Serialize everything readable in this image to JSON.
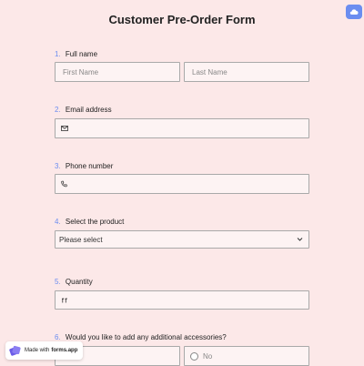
{
  "form": {
    "title": "Customer Pre-Order Form",
    "questions": [
      {
        "num": "1.",
        "label": "Full name",
        "first_placeholder": "First Name",
        "last_placeholder": "Last Name"
      },
      {
        "num": "2.",
        "label": "Email address"
      },
      {
        "num": "3.",
        "label": "Phone number"
      },
      {
        "num": "4.",
        "label": "Select the product",
        "selected": "Please select"
      },
      {
        "num": "5.",
        "label": "Quantity"
      },
      {
        "num": "6.",
        "label": "Would you like to add any additional accessories?",
        "options": [
          "No"
        ]
      }
    ]
  },
  "badge": {
    "prefix": "Made with",
    "brand": "forms.app"
  },
  "icons": [
    "cloud-icon",
    "mail-icon",
    "phone-icon",
    "chevron-down-icon",
    "number-icon",
    "forms-app-logo-icon"
  ],
  "colors": {
    "background": "#fce8e8",
    "accent": "#6b8df0",
    "field_bg": "#fdf3f3",
    "field_border": "#a9a9a9"
  }
}
